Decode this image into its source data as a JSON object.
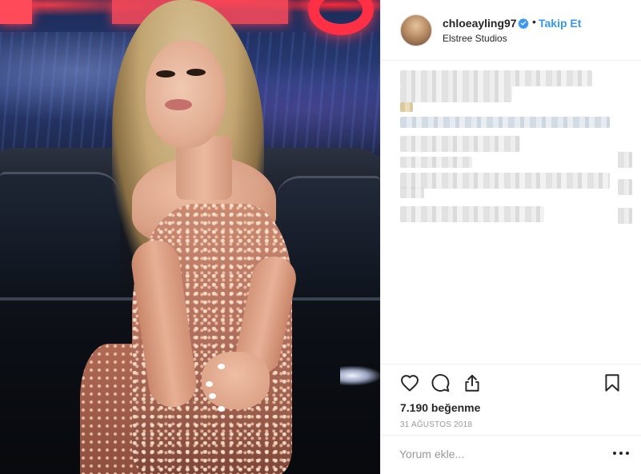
{
  "post": {
    "username": "chloeayling97",
    "follow_label": "Takip Et",
    "separator": "•",
    "location": "Elstree Studios",
    "likes_text": "7.190 beğenme",
    "date_text": "31 AĞUSTOS 2018",
    "comment_placeholder": "Yorum ekle..."
  },
  "icons": {
    "verified": "verified-badge-icon",
    "like": "heart-icon",
    "comment": "comment-bubble-icon",
    "share": "share-icon",
    "save": "bookmark-icon",
    "more": "more-options-icon"
  },
  "colors": {
    "accent": "#3897f0",
    "text": "#262626",
    "muted": "#999999",
    "divider": "#efefef"
  }
}
